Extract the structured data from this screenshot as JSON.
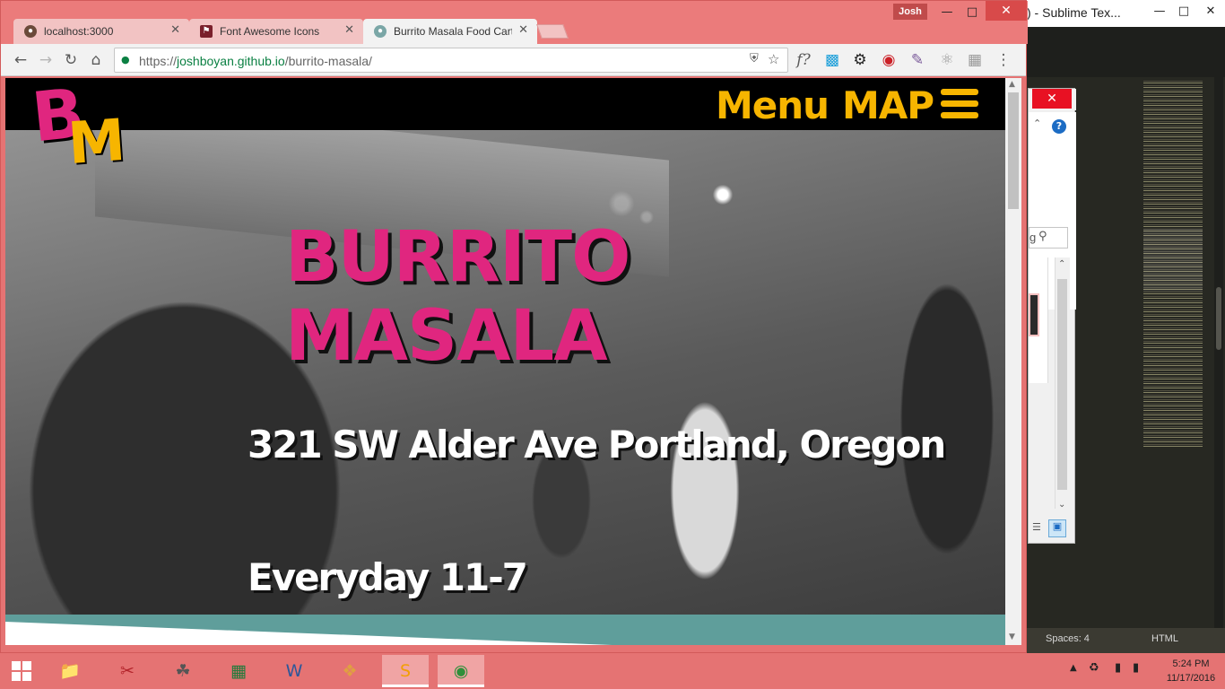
{
  "sublime": {
    "title": ") - Sublime Tex...",
    "status": {
      "spaces": "Spaces: 4",
      "syntax": "HTML"
    }
  },
  "dialog": {
    "search_placeholder": "g"
  },
  "browser": {
    "profile_name": "Josh",
    "tabs": [
      {
        "title": "localhost:3000",
        "active": false,
        "favicon": "globe-icon"
      },
      {
        "title": "Font Awesome Icons",
        "active": false,
        "favicon": "flag-icon"
      },
      {
        "title": "Burrito Masala Food Cart",
        "active": true,
        "favicon": "github-icon"
      }
    ],
    "url": {
      "scheme": "https://",
      "host": "joshboyan.github.io",
      "path": "/burrito-masala/"
    },
    "extensions": [
      "formula-icon",
      "feedly-icon",
      "gear-icon",
      "pinterest-icon",
      "eyedropper-icon",
      "react-icon",
      "qr-icon",
      "more-icon"
    ]
  },
  "site": {
    "logo": {
      "b": "B",
      "m": "M"
    },
    "nav": {
      "menu": "Menu",
      "map": "MAP"
    },
    "hero": {
      "title_line1": "BURRITO",
      "title_line2": "MASALA",
      "address": "321 SW Alder Ave Portland, Oregon",
      "hours": "Everyday 11-7"
    },
    "colors": {
      "pink": "#e0267f",
      "gold": "#f7b500",
      "teal": "#5f9e9b",
      "header": "#000000"
    }
  },
  "taskbar": {
    "apps": [
      "file-explorer-icon",
      "snipping-tool-icon",
      "gimp-icon",
      "calculator-icon",
      "word-icon",
      "app-icon",
      "sublime-text-icon",
      "chrome-icon"
    ],
    "clock": {
      "time": "5:24 PM",
      "date": "11/17/2016"
    }
  }
}
